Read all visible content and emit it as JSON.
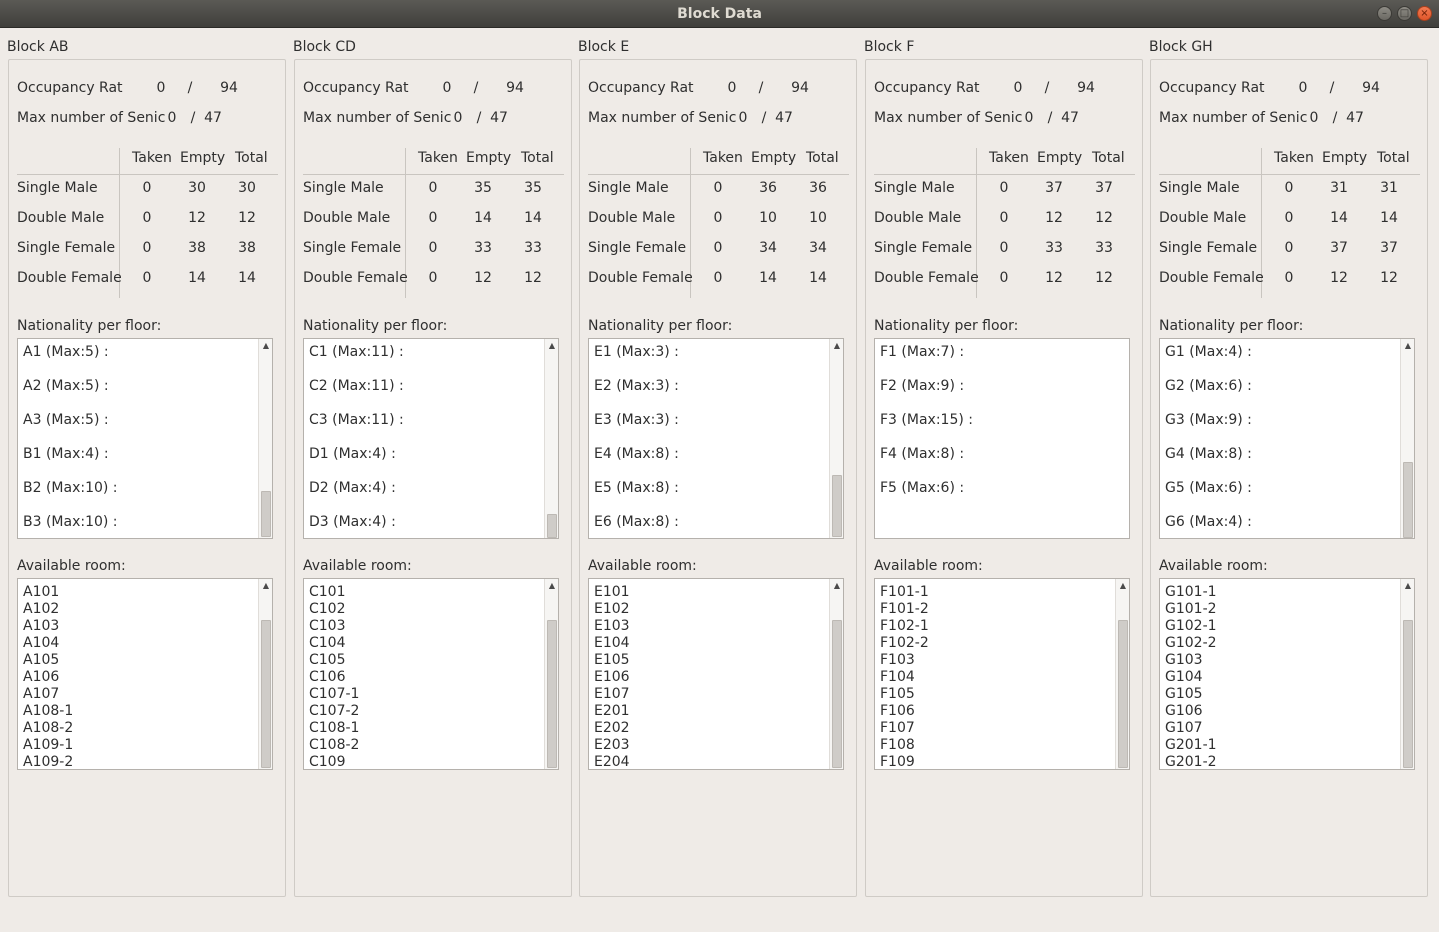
{
  "window": {
    "title": "Block Data"
  },
  "labels": {
    "occupancy": "Occupancy Rat",
    "max_senior": "Max number of Senic",
    "slash": "/",
    "col_taken": "Taken",
    "col_empty": "Empty",
    "col_total": "Total",
    "row_single_male": "Single Male",
    "row_double_male": "Double Male",
    "row_single_female": "Single Female",
    "row_double_female": "Double Female",
    "nationality": "Nationality per floor:",
    "available": "Available room:"
  },
  "blocks": [
    {
      "name": "Block AB",
      "occupancy": [
        "0",
        "94"
      ],
      "senior": [
        "0",
        "47"
      ],
      "rows": [
        [
          "0",
          "30",
          "30"
        ],
        [
          "0",
          "12",
          "12"
        ],
        [
          "0",
          "38",
          "38"
        ],
        [
          "0",
          "14",
          "14"
        ]
      ],
      "nationality": [
        "A1 (Max:5) :",
        "A2 (Max:5) :",
        "A3 (Max:5) :",
        "B1 (Max:4) :",
        "B2 (Max:10) :",
        "B3 (Max:10) :"
      ],
      "rooms": [
        "A101",
        "A102",
        "A103",
        "A104",
        "A105",
        "A106",
        "A107",
        "A108-1",
        "A108-2",
        "A109-1",
        "A109-2"
      ]
    },
    {
      "name": "Block CD",
      "occupancy": [
        "0",
        "94"
      ],
      "senior": [
        "0",
        "47"
      ],
      "rows": [
        [
          "0",
          "35",
          "35"
        ],
        [
          "0",
          "14",
          "14"
        ],
        [
          "0",
          "33",
          "33"
        ],
        [
          "0",
          "12",
          "12"
        ]
      ],
      "nationality": [
        "C1 (Max:11) :",
        "C2 (Max:11) :",
        "C3 (Max:11) :",
        "D1 (Max:4) :",
        "D2 (Max:4) :",
        "D3 (Max:4) :"
      ],
      "rooms": [
        "C101",
        "C102",
        "C103",
        "C104",
        "C105",
        "C106",
        "C107-1",
        "C107-2",
        "C108-1",
        "C108-2",
        "C109"
      ]
    },
    {
      "name": "Block E",
      "occupancy": [
        "0",
        "94"
      ],
      "senior": [
        "0",
        "47"
      ],
      "rows": [
        [
          "0",
          "36",
          "36"
        ],
        [
          "0",
          "10",
          "10"
        ],
        [
          "0",
          "34",
          "34"
        ],
        [
          "0",
          "14",
          "14"
        ]
      ],
      "nationality": [
        "E1 (Max:3) :",
        "E2 (Max:3) :",
        "E3 (Max:3) :",
        "E4 (Max:8) :",
        "E5 (Max:8) :",
        "E6 (Max:8) :"
      ],
      "rooms": [
        "E101",
        "E102",
        "E103",
        "E104",
        "E105",
        "E106",
        "E107",
        "E201",
        "E202",
        "E203",
        "E204"
      ]
    },
    {
      "name": "Block F",
      "occupancy": [
        "0",
        "94"
      ],
      "senior": [
        "0",
        "47"
      ],
      "rows": [
        [
          "0",
          "37",
          "37"
        ],
        [
          "0",
          "12",
          "12"
        ],
        [
          "0",
          "33",
          "33"
        ],
        [
          "0",
          "12",
          "12"
        ]
      ],
      "nationality": [
        "F1 (Max:7) :",
        "F2 (Max:9) :",
        "F3 (Max:15) :",
        "F4 (Max:8) :",
        "F5 (Max:6) :"
      ],
      "rooms": [
        "F101-1",
        "F101-2",
        "F102-1",
        "F102-2",
        "F103",
        "F104",
        "F105",
        "F106",
        "F107",
        "F108",
        "F109"
      ]
    },
    {
      "name": "Block GH",
      "occupancy": [
        "0",
        "94"
      ],
      "senior": [
        "0",
        "47"
      ],
      "rows": [
        [
          "0",
          "31",
          "31"
        ],
        [
          "0",
          "14",
          "14"
        ],
        [
          "0",
          "37",
          "37"
        ],
        [
          "0",
          "12",
          "12"
        ]
      ],
      "nationality": [
        "G1 (Max:4) :",
        "G2 (Max:6) :",
        "G3 (Max:9) :",
        "G4 (Max:8) :",
        "G5 (Max:6) :",
        "G6 (Max:4) :"
      ],
      "rooms": [
        "G101-1",
        "G101-2",
        "G102-1",
        "G102-2",
        "G103",
        "G104",
        "G105",
        "G106",
        "G107",
        "G201-1",
        "G201-2"
      ]
    }
  ]
}
